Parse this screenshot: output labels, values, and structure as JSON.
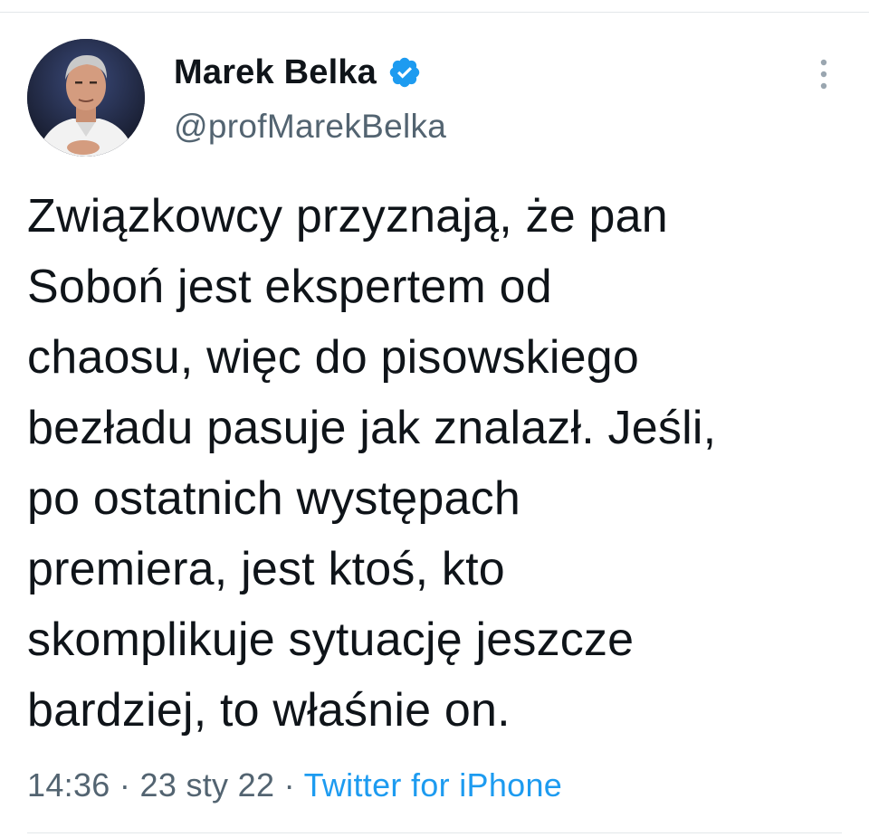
{
  "author": {
    "display_name": "Marek Belka",
    "handle": "@profMarekBelka",
    "verified": true,
    "avatar_icon": "profile-photo"
  },
  "tweet": {
    "lines": [
      "Związkowcy przyznają, że pan",
      "Soboń jest ekspertem od",
      "chaosu, więc do pisowskiego",
      "bezładu pasuje jak znalazł. Jeśli,",
      "po ostatnich występach",
      "premiera, jest ktoś, kto",
      "skomplikuje sytuację jeszcze",
      "bardziej, to właśnie on."
    ],
    "time": "14:36",
    "separator": "·",
    "date": "23 sty 22",
    "source": "Twitter for iPhone"
  },
  "colors": {
    "link": "#1d9bf0",
    "secondary_text": "#536471",
    "primary_text": "#0f1419",
    "verified_badge": "#1d9bf0"
  },
  "icons": {
    "more": "more-vertical-icon",
    "verified": "verified-badge-icon"
  }
}
